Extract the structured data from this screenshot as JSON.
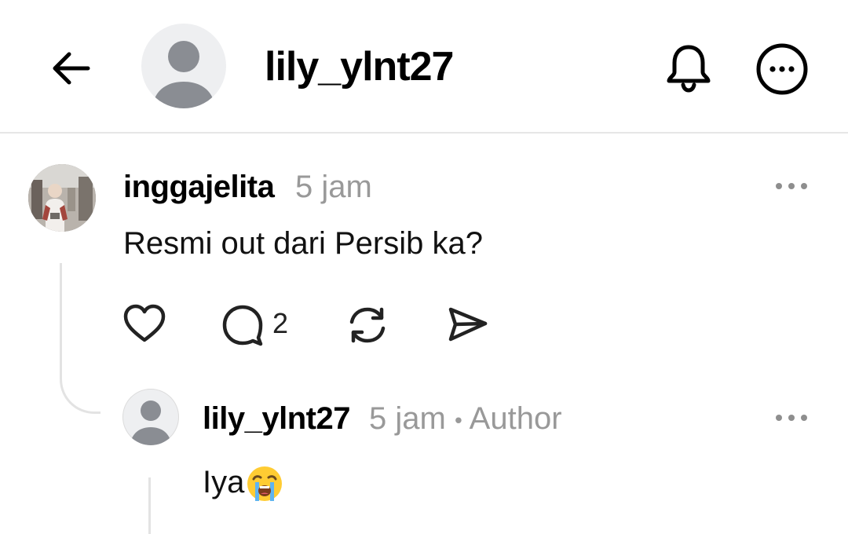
{
  "header": {
    "title": "lily_ylnt27",
    "back_icon": "arrow-left-icon",
    "bell_icon": "bell-icon",
    "more_icon": "more-circle-icon"
  },
  "comment": {
    "username": "inggajelita",
    "time": "5 jam",
    "text": "Resmi out dari Persib ka?",
    "actions": {
      "like_icon": "heart-icon",
      "reply_icon": "comment-icon",
      "reply_count": "2",
      "repost_icon": "repost-icon",
      "share_icon": "send-icon"
    }
  },
  "reply": {
    "username": "lily_ylnt27",
    "time": "5 jam",
    "separator": "•",
    "badge": "Author",
    "text": "Iya",
    "emoji": "loudly-crying-face"
  },
  "colors": {
    "divider": "#e6e6e6",
    "meta_text": "#999999",
    "avatar_bg": "#eeeff1",
    "avatar_figure": "#8a8d93"
  }
}
